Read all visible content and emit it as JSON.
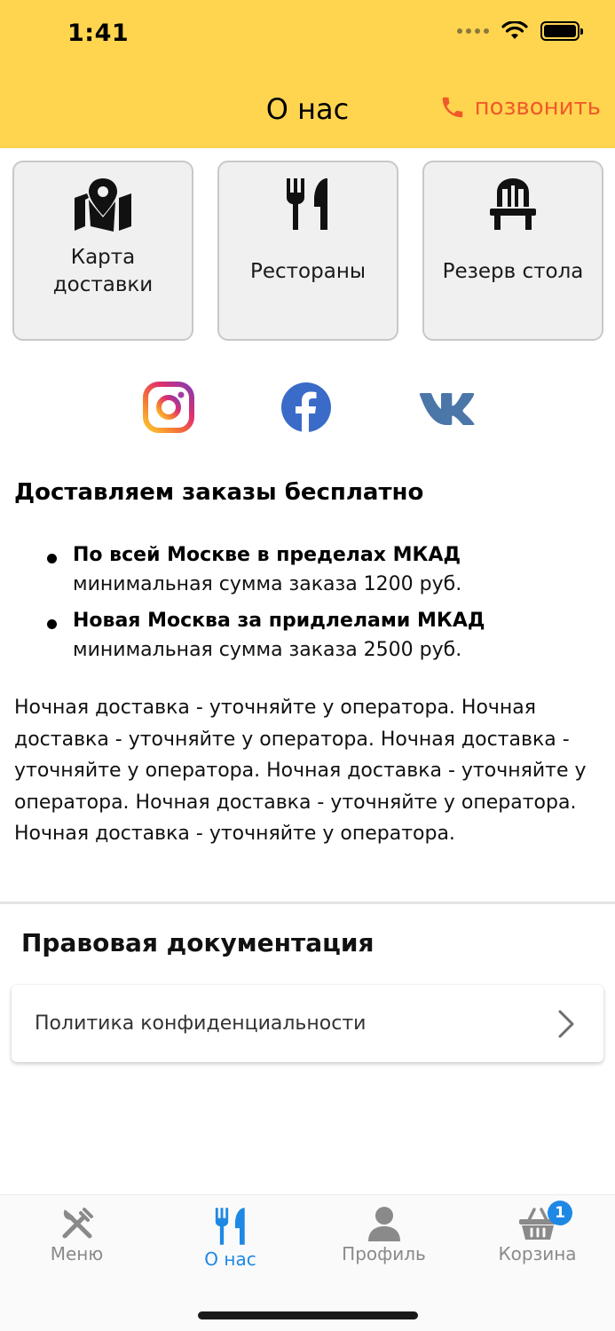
{
  "status_bar": {
    "time": "1:41"
  },
  "header": {
    "title": "О нас",
    "call_label": "позвонить"
  },
  "colors": {
    "header_bg": "#FFD54F",
    "call": "#F05A2A",
    "accent": "#1E88E5",
    "tab_inactive": "#8a8a8a"
  },
  "tiles": [
    {
      "label": "Карта доставки",
      "icon": "map-pin-icon"
    },
    {
      "label": "Рестораны",
      "icon": "fork-knife-icon"
    },
    {
      "label": "Резерв стола",
      "icon": "chair-icon"
    }
  ],
  "social": [
    {
      "icon": "instagram-icon"
    },
    {
      "icon": "facebook-icon"
    },
    {
      "icon": "vk-icon"
    }
  ],
  "delivery": {
    "title": "Доставляем заказы бесплатно",
    "items": [
      {
        "title": "По всей Москве в пределах МКАД",
        "subtitle": "минимальная сумма заказа 1200 руб."
      },
      {
        "title": "Новая Москва за придлелами МКАД",
        "subtitle": "минимальная сумма заказа 2500 руб."
      }
    ],
    "night_text": "Ночная доставка - уточняйте у оператора. Ночная доставка - уточняйте у оператора. Ночная доставка - уточняйте у оператора. Ночная доставка - уточняйте у оператора. Ночная доставка - уточняйте у оператора. Ночная доставка - уточняйте у оператора."
  },
  "legal": {
    "title": "Правовая документация",
    "items": [
      {
        "label": "Политика конфиденциальности"
      }
    ]
  },
  "tabbar": {
    "tabs": [
      {
        "label": "Меню",
        "icon": "utensils-cross-icon",
        "active": false
      },
      {
        "label": "О нас",
        "icon": "fork-knife-icon",
        "active": true
      },
      {
        "label": "Профиль",
        "icon": "user-icon",
        "active": false
      },
      {
        "label": "Корзина",
        "icon": "basket-icon",
        "active": false,
        "badge": "1"
      }
    ]
  }
}
